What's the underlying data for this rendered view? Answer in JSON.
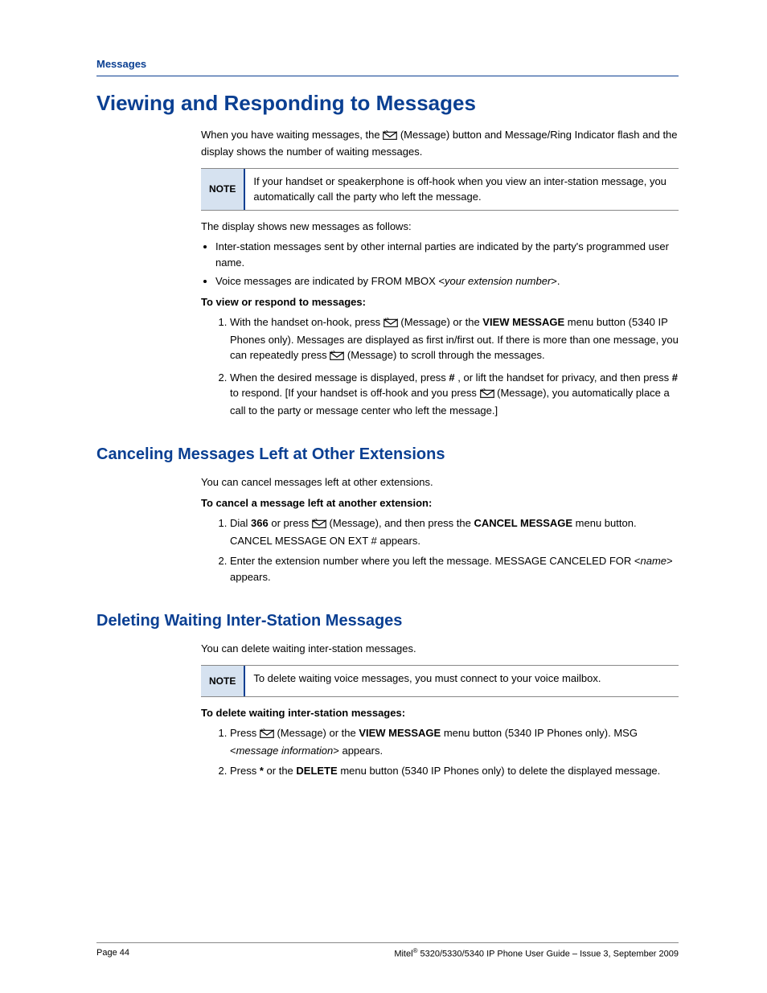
{
  "breadcrumb": "Messages",
  "sections": {
    "viewing": {
      "title": "Viewing and Responding to Messages",
      "p1a": "When you have waiting messages, the ",
      "p1b": " (Message) button and Message/Ring Indicator flash and the display shows the number of waiting messages.",
      "note_label": "NOTE",
      "note_text": "If your handset or speakerphone is off-hook when you view an inter-station message, you automatically call the party who left the message.",
      "p2": "The display shows new messages as follows:",
      "bullets": {
        "b1": "Inter-station messages sent by other internal parties are indicated by the party's programmed user name.",
        "b2a": "Voice messages are indicated by FROM MBOX <",
        "b2i": "your extension number",
        "b2b": ">."
      },
      "lead": "To view or respond to messages:",
      "steps": {
        "s1a": "With the handset on-hook, press ",
        "s1b": " (Message) or the ",
        "s1_bold": "VIEW MESSAGE",
        "s1c": " menu button (5340 IP Phones only). Messages are displayed as first in/first out. If there is more than one message, you can repeatedly press ",
        "s1d": " (Message) to scroll through the messages.",
        "s2a": "When the desired message is displayed, press ",
        "s2_hash1": "#",
        "s2b": ", or lift the handset for privacy, and then press ",
        "s2_hash2": "#",
        "s2c": " to respond. [If your handset is off-hook and you press ",
        "s2d": " (Message), you automatically place a call to the party or message center who left the message.]"
      }
    },
    "canceling": {
      "title": "Canceling Messages Left at Other Extensions",
      "p1": "You can cancel messages left at other extensions.",
      "lead": "To cancel a message left at another extension:",
      "steps": {
        "s1a": "Dial ",
        "s1_bold1": "366",
        "s1b": " or press ",
        "s1c": " (Message), and then press the ",
        "s1_bold2": "CANCEL MESSAGE",
        "s1d": " menu button. CANCEL MESSAGE ON EXT # appears.",
        "s2a": "Enter the extension number where you left the message. MESSAGE CANCELED FOR <",
        "s2i": "name",
        "s2b": "> appears."
      }
    },
    "deleting": {
      "title": "Deleting Waiting Inter-Station Messages",
      "p1": "You can delete waiting inter-station messages.",
      "note_label": "NOTE",
      "note_text": "To delete waiting voice messages, you must connect to your voice mailbox.",
      "lead": "To delete waiting inter-station messages:",
      "steps": {
        "s1a": "Press ",
        "s1b": " (Message) or the ",
        "s1_bold": "VIEW MESSAGE",
        "s1c": " menu button (5340 IP Phones only). MSG <",
        "s1i": "message information",
        "s1d": "> appears.",
        "s2a": "Press ",
        "s2_ast": "*",
        "s2b": " or the ",
        "s2_bold": "DELETE",
        "s2c": " menu button (5340 IP Phones only) to delete the displayed message."
      }
    }
  },
  "footer": {
    "left": "Page 44",
    "right_a": "Mitel",
    "right_sup": "®",
    "right_b": " 5320/5330/5340 IP Phone User Guide – Issue 3, September 2009"
  }
}
